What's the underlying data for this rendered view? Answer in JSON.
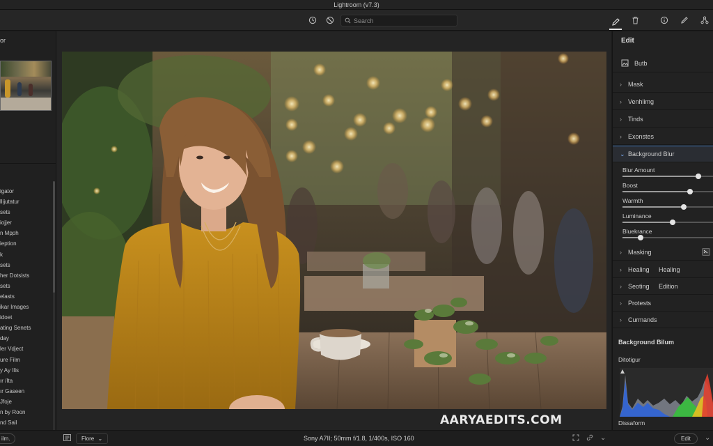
{
  "app": {
    "title": "Lightroom (v7.3)"
  },
  "toolbar": {
    "search_placeholder": "Search",
    "left_icons": [
      "history-icon",
      "compare-icon"
    ],
    "right_icons": [
      "brush-icon",
      "trash-icon",
      "info-icon",
      "pen-icon",
      "share-icon"
    ]
  },
  "left_panel": {
    "title": "or",
    "presets": [
      "igator",
      "llijutatur",
      "sets",
      "iojjer",
      "n Mpph",
      "ieption",
      "k",
      "sets",
      "her Dotsists",
      "sets",
      "elasts",
      "ikar Images",
      "idoet",
      "ating Senets",
      "day",
      "ler Vdject",
      "ure Film",
      "y Ay Ilis",
      "ır /Ita",
      "ır Gaseen",
      "Jfoje",
      "n by Roon",
      "nd Sail"
    ]
  },
  "center": {
    "watermark": "AARYAEDITS.COM"
  },
  "right_panel": {
    "header": "Edit",
    "auto_label": "Butb",
    "sections_top": [
      {
        "label": "Mask"
      },
      {
        "label": "Venhlimg"
      },
      {
        "label": "Tinds"
      },
      {
        "label": "Exonstes"
      }
    ],
    "active_section": "Background Blur",
    "sliders": [
      {
        "label": "Blur Amount",
        "value": 0.83
      },
      {
        "label": "Boost",
        "value": 0.74
      },
      {
        "label": "Warmth",
        "value": 0.67
      },
      {
        "label": "Luminance",
        "value": 0.55
      },
      {
        "label": "Bluekrance",
        "value": 0.2
      }
    ],
    "sections_bottom": [
      {
        "label": "Masking",
        "label2": ""
      },
      {
        "label": "Healing",
        "label2": "Healing"
      },
      {
        "label": "Seoting",
        "label2": "Edition"
      },
      {
        "label": "Protests",
        "label2": ""
      },
      {
        "label": "Curmands",
        "label2": ""
      }
    ],
    "lower_title": "Background Bilum",
    "histogram_label": "Ditotigur",
    "footer_label": "Dissaform"
  },
  "bottom_bar": {
    "left_pill": "ilm.",
    "filter_label": "Flore",
    "camera_info": "Sony A7II; 50mm f/1.8, 1/400s, ISO 160",
    "edit_button": "Edit"
  },
  "colors": {
    "accent": "#3a6fb0",
    "histogram_blue": "#2f64d8",
    "histogram_green": "#36c03c",
    "histogram_yellow": "#e6c020",
    "histogram_red": "#e04030"
  }
}
